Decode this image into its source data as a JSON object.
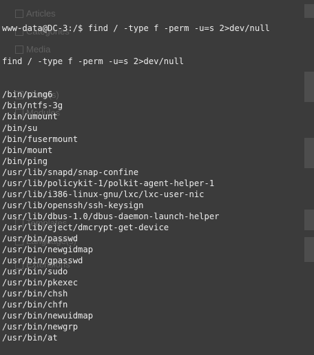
{
  "terminal": {
    "prompt_line": "www-data@DC-3:/$ find / -type f -perm -u=s 2>dev/null",
    "echo_line": "find / -type f -perm -u=s 2>dev/null",
    "output": [
      "/bin/ping6",
      "/bin/ntfs-3g",
      "/bin/umount",
      "/bin/su",
      "/bin/fusermount",
      "/bin/mount",
      "/bin/ping",
      "/usr/lib/snapd/snap-confine",
      "/usr/lib/policykit-1/polkit-agent-helper-1",
      "/usr/lib/i386-linux-gnu/lxc/lxc-user-nic",
      "/usr/lib/openssh/ssh-keysign",
      "/usr/lib/dbus-1.0/dbus-daemon-launch-helper",
      "/usr/lib/eject/dmcrypt-get-device",
      "/usr/bin/passwd",
      "/usr/bin/newgidmap",
      "/usr/bin/gpasswd",
      "/usr/bin/sudo",
      "/usr/bin/pkexec",
      "/usr/bin/chsh",
      "/usr/bin/chfn",
      "/usr/bin/newuidmap",
      "/usr/bin/newgrp",
      "/usr/bin/at"
    ]
  },
  "background": {
    "items": [
      "Articles",
      "Categories",
      "Media",
      "Menu(s)",
      "Modules",
      "Templates",
      "Language(s)",
      "Extensions"
    ]
  }
}
